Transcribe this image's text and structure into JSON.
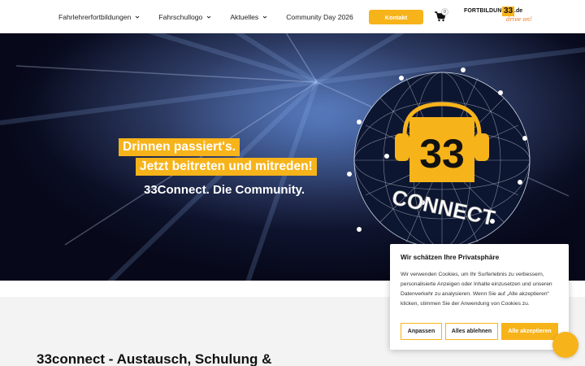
{
  "nav": {
    "items": [
      {
        "label": "Fahrlehrerfortbildungen",
        "has_dropdown": true
      },
      {
        "label": "Fahrschullogo",
        "has_dropdown": true
      },
      {
        "label": "Aktuelles",
        "has_dropdown": true
      },
      {
        "label": "Community Day 2026",
        "has_dropdown": false
      }
    ],
    "contact_label": "Kontakt",
    "cart_count": "0",
    "logo": {
      "brand": "FORTBILDUNG",
      "number": "33",
      "tld": ".de",
      "tagline": "drive on!"
    }
  },
  "hero": {
    "line1": "Drinnen passiert's.",
    "line2": "Jetzt beitreten und mitreden!",
    "subline": "33Connect. Die Community.",
    "globe_number": "33",
    "globe_word": "CONNECT"
  },
  "intro": {
    "title": "33connect - Austausch, Schulung &"
  },
  "cookie": {
    "title": "Wir schätzen Ihre Privatsphäre",
    "text": "Wir verwenden Cookies, um Ihr Surferlebnis zu verbessern, personalisierte Anzeigen oder Inhalte einzusetzen und unseren Datenverkehr zu analysieren. Wenn Sie auf „Alle akzeptieren“ klicken, stimmen Sie der Anwendung von Cookies zu.",
    "btn_customize": "Anpassen",
    "btn_reject": "Alles ablehnen",
    "btn_accept": "Alle akzeptieren"
  },
  "colors": {
    "accent": "#f7b31a",
    "hero_dark": "#07091a"
  }
}
